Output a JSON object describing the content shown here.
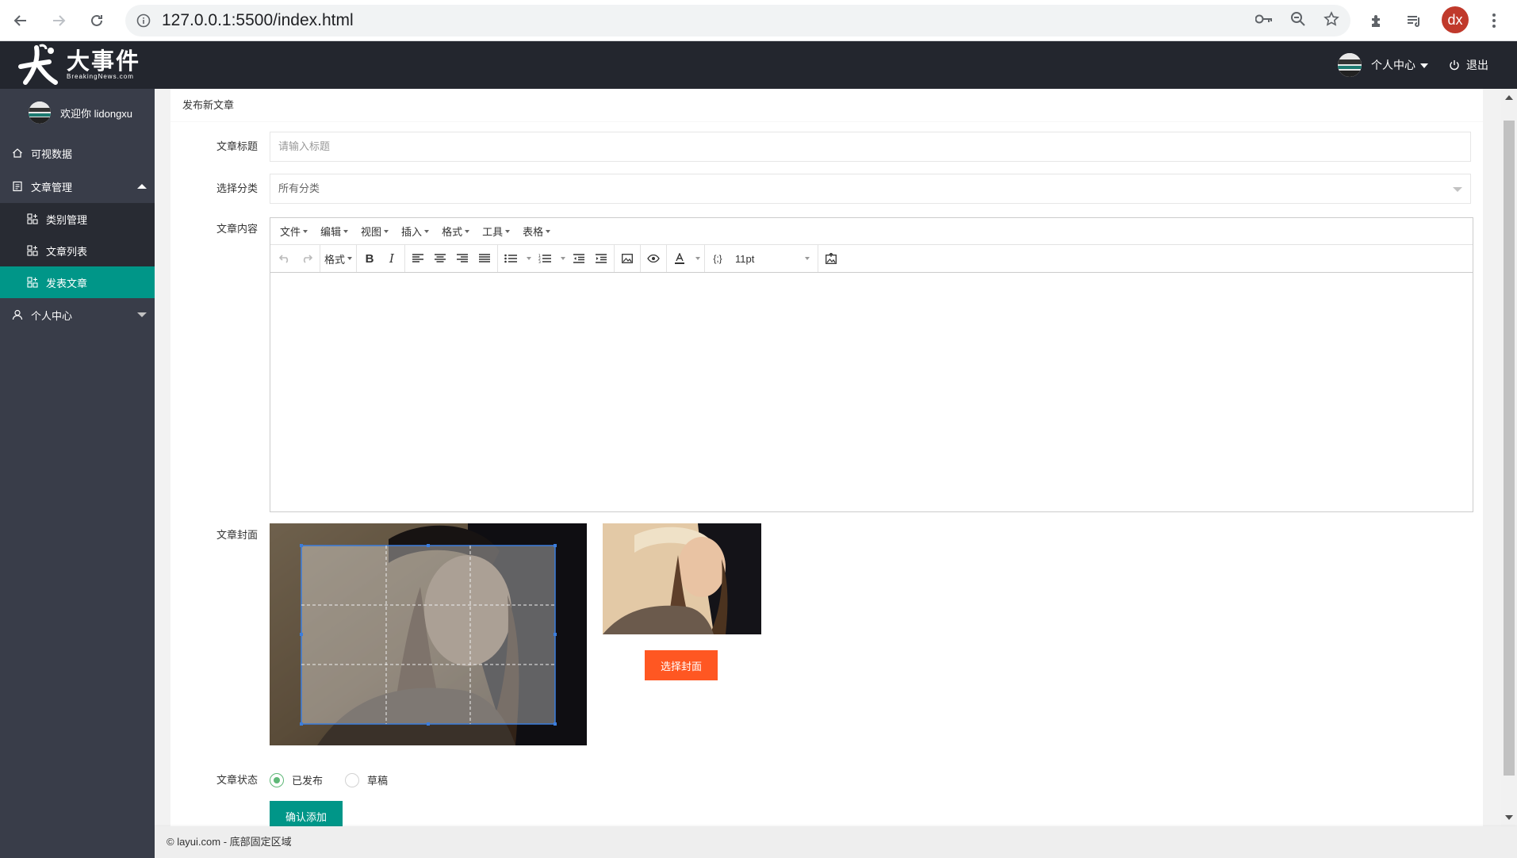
{
  "browser": {
    "url": "127.0.0.1:5500/index.html",
    "profile_initials": "dx"
  },
  "header": {
    "logo_cn": "大事件",
    "logo_en": "BreakingNews.com",
    "user_center": "个人中心",
    "logout": "退出"
  },
  "sidebar": {
    "welcome": "欢迎你 lidongxu",
    "items": [
      {
        "label": "可视数据",
        "icon": "home-icon"
      },
      {
        "label": "文章管理",
        "icon": "article-icon",
        "expanded": true
      },
      {
        "label": "类别管理",
        "icon": "grid-icon"
      },
      {
        "label": "文章列表",
        "icon": "grid-icon"
      },
      {
        "label": "发表文章",
        "icon": "grid-icon",
        "selected": true
      },
      {
        "label": "个人中心",
        "icon": "user-icon",
        "expanded": false
      }
    ]
  },
  "card": {
    "title": "发布新文章"
  },
  "form": {
    "title_label": "文章标题",
    "title_placeholder": "请输入标题",
    "category_label": "选择分类",
    "category_value": "所有分类",
    "content_label": "文章内容",
    "cover_label": "文章封面",
    "choose_cover": "选择封面",
    "status_label": "文章状态",
    "status_options": [
      "已发布",
      "草稿"
    ],
    "status_selected": "已发布",
    "submit": "确认添加"
  },
  "editor": {
    "menus": [
      "文件",
      "编辑",
      "视图",
      "插入",
      "格式",
      "工具",
      "表格"
    ],
    "format_label": "格式",
    "font_size": "11pt"
  },
  "footer": {
    "text": "© layui.com - 底部固定区域"
  },
  "colors": {
    "header_bg": "#23262e",
    "sidebar_bg": "#393d49",
    "accent_green": "#009688",
    "accent_orange": "#ff5722"
  }
}
